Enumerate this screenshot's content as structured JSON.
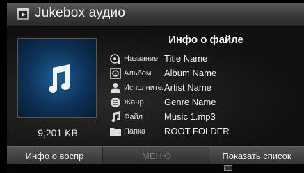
{
  "window": {
    "title": "Jukebox аудио",
    "app_icon": "video-file-icon"
  },
  "album": {
    "icon": "music-note-icon",
    "file_size": "9,201 KB"
  },
  "info": {
    "title": "Инфо о файле",
    "rows": [
      {
        "icon": "title-icon",
        "label": "Название",
        "value": "Title Name"
      },
      {
        "icon": "album-icon",
        "label": "Альбом",
        "value": "Album Name"
      },
      {
        "icon": "artist-icon",
        "label": "Исполнител",
        "value": "Artist Name"
      },
      {
        "icon": "genre-icon",
        "label": "Жанр",
        "value": "Genre Name"
      },
      {
        "icon": "file-icon",
        "label": "Файл",
        "value": "Music 1.mp3"
      },
      {
        "icon": "folder-icon",
        "label": "Папка",
        "value": "ROOT FOLDER"
      }
    ]
  },
  "bottom": {
    "left_label": "Инфо о воспр",
    "menu_label": "МЕНЮ",
    "right_label": "Показать список"
  },
  "colors": {
    "album_bg": "#0d3258",
    "accent": "#1f5f95"
  }
}
